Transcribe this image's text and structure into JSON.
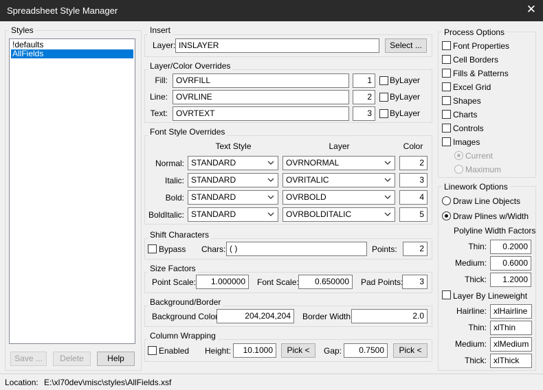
{
  "window": {
    "title": "Spreadsheet Style Manager",
    "close_glyph": "✕"
  },
  "styles": {
    "label": "Styles",
    "items": [
      "!defaults",
      "AllFields"
    ],
    "selected": "AllFields",
    "save_label": "Save ...",
    "delete_label": "Delete",
    "help_label": "Help"
  },
  "insert": {
    "label": "Insert",
    "layer_label": "Layer:",
    "layer_value": "INSLAYER",
    "select_label": "Select ..."
  },
  "layer_color": {
    "label": "Layer/Color Overrides",
    "bylayer_label": "ByLayer",
    "rows": [
      {
        "label": "Fill:",
        "layer": "OVRFILL",
        "color": "1",
        "bylayer": false
      },
      {
        "label": "Line:",
        "layer": "OVRLINE",
        "color": "2",
        "bylayer": false
      },
      {
        "label": "Text:",
        "layer": "OVRTEXT",
        "color": "3",
        "bylayer": false
      }
    ]
  },
  "font_style": {
    "label": "Font Style Overrides",
    "col_text_style": "Text Style",
    "col_layer": "Layer",
    "col_color": "Color",
    "rows": [
      {
        "label": "Normal:",
        "text_style": "STANDARD",
        "layer": "OVRNORMAL",
        "color": "2"
      },
      {
        "label": "Italic:",
        "text_style": "STANDARD",
        "layer": "OVRITALIC",
        "color": "3"
      },
      {
        "label": "Bold:",
        "text_style": "STANDARD",
        "layer": "OVRBOLD",
        "color": "4"
      },
      {
        "label": "BoldItalic:",
        "text_style": "STANDARD",
        "layer": "OVRBOLDITALIC",
        "color": "5"
      }
    ]
  },
  "shift": {
    "label": "Shift Characters",
    "bypass_label": "Bypass",
    "bypass": false,
    "chars_label": "Chars:",
    "chars_value": "( )",
    "points_label": "Points:",
    "points_value": "2"
  },
  "size": {
    "label": "Size Factors",
    "point_scale_label": "Point Scale:",
    "point_scale": "1.000000",
    "font_scale_label": "Font Scale:",
    "font_scale": "0.650000",
    "pad_points_label": "Pad Points:",
    "pad_points": "3"
  },
  "background": {
    "label": "Background/Border",
    "bg_color_label": "Background Color:",
    "bg_color": "204,204,204",
    "border_width_label": "Border Width:",
    "border_width": "2.0"
  },
  "wrapping": {
    "label": "Column Wrapping",
    "enabled_label": "Enabled",
    "enabled": false,
    "height_label": "Height:",
    "height": "10.1000",
    "pick_label": "Pick <",
    "gap_label": "Gap:",
    "gap": "0.7500"
  },
  "process": {
    "label": "Process Options",
    "options": [
      {
        "label": "Font Properties",
        "checked": false
      },
      {
        "label": "Cell Borders",
        "checked": false
      },
      {
        "label": "Fills & Patterns",
        "checked": false
      },
      {
        "label": "Excel Grid",
        "checked": false
      },
      {
        "label": "Shapes",
        "checked": false
      },
      {
        "label": "Charts",
        "checked": false
      },
      {
        "label": "Controls",
        "checked": false
      },
      {
        "label": "Images",
        "checked": false
      }
    ],
    "image_modes": [
      {
        "label": "Current",
        "selected": true
      },
      {
        "label": "Maximum",
        "selected": false
      }
    ]
  },
  "linework": {
    "label": "Linework Options",
    "draw_line_label": "Draw Line Objects",
    "draw_line": false,
    "draw_plines_label": "Draw Plines w/Width",
    "draw_plines": true,
    "factors_label": "Polyline Width Factors",
    "factors": [
      {
        "label": "Thin:",
        "value": "0.2000"
      },
      {
        "label": "Medium:",
        "value": "0.6000"
      },
      {
        "label": "Thick:",
        "value": "1.2000"
      }
    ],
    "layer_by_lw_label": "Layer By Lineweight",
    "layer_by_lw": false,
    "lw_layers": [
      {
        "label": "Hairline:",
        "value": "xlHairline"
      },
      {
        "label": "Thin:",
        "value": "xlThin"
      },
      {
        "label": "Medium:",
        "value": "xlMedium"
      },
      {
        "label": "Thick:",
        "value": "xlThick"
      }
    ]
  },
  "status": {
    "location_label": "Location:",
    "location_value": "E:\\xl70dev\\misc\\styles\\AllFields.xsf"
  }
}
